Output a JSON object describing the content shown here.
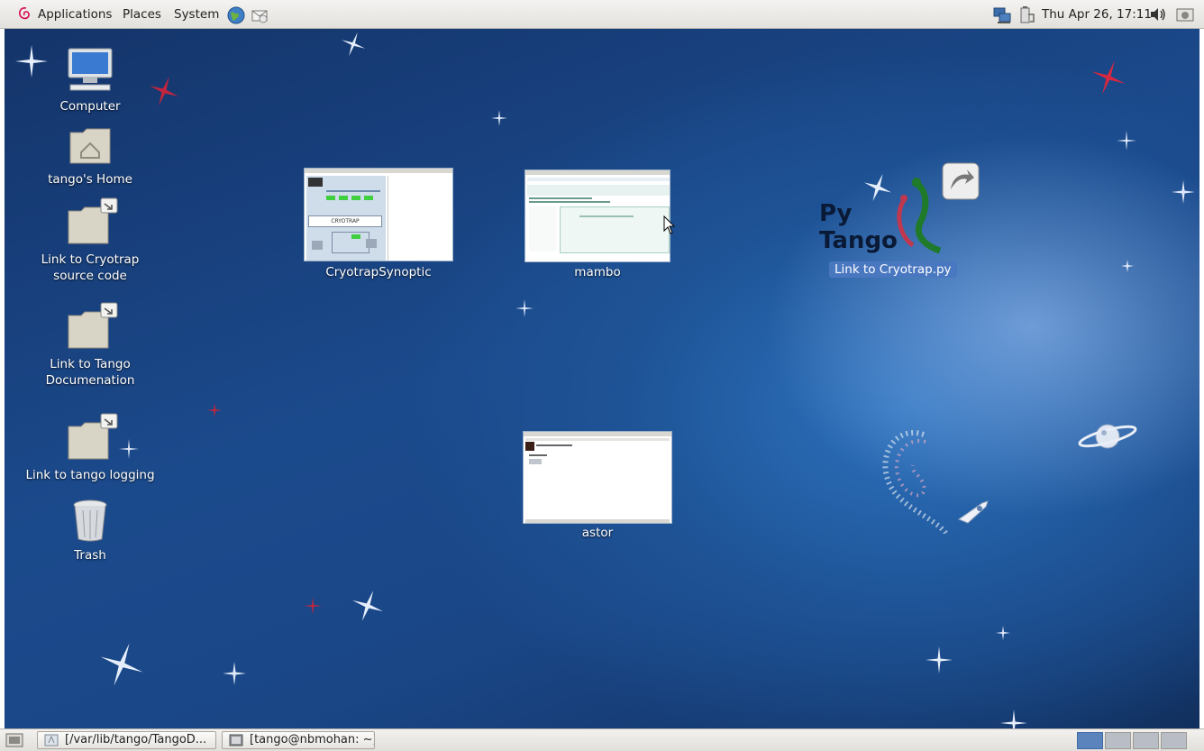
{
  "top_panel": {
    "menus": {
      "applications": "Applications",
      "places": "Places",
      "system": "System"
    },
    "launchers": [
      "web-browser-icon",
      "mail-client-icon"
    ],
    "tray": [
      "network-icon",
      "battery-icon",
      "volume-icon",
      "screenshot-icon"
    ],
    "clock": "Thu Apr 26, 17:11"
  },
  "desktop": {
    "icons": {
      "computer": "Computer",
      "home": "tango's Home",
      "cryotrap_source_line1": "Link to Cryotrap",
      "cryotrap_source_line2": "source code",
      "tango_doc_line1": "Link to Tango",
      "tango_doc_line2": "Documenation",
      "tango_logging": "Link to tango logging",
      "trash": "Trash"
    },
    "thumbnails": {
      "cryotrap_synoptic": "CryotrapSynoptic",
      "cryotrap_synoptic_inner_label": "CRYOTRAP",
      "mambo": "mambo",
      "astor": "astor"
    },
    "pytango_link": {
      "logo_line1": "Py",
      "logo_line2": "Tango",
      "label": "Link to Cryotrap.py"
    }
  },
  "bottom_panel": {
    "tasks": [
      "[/var/lib/tango/TangoD...",
      "[tango@nbmohan: ~]"
    ],
    "workspaces": 4,
    "active_workspace": 1
  },
  "colors": {
    "desktop_blue": "#1b4a8c",
    "selection": "#4a78c0",
    "workspace_active": "#5b84bd"
  }
}
